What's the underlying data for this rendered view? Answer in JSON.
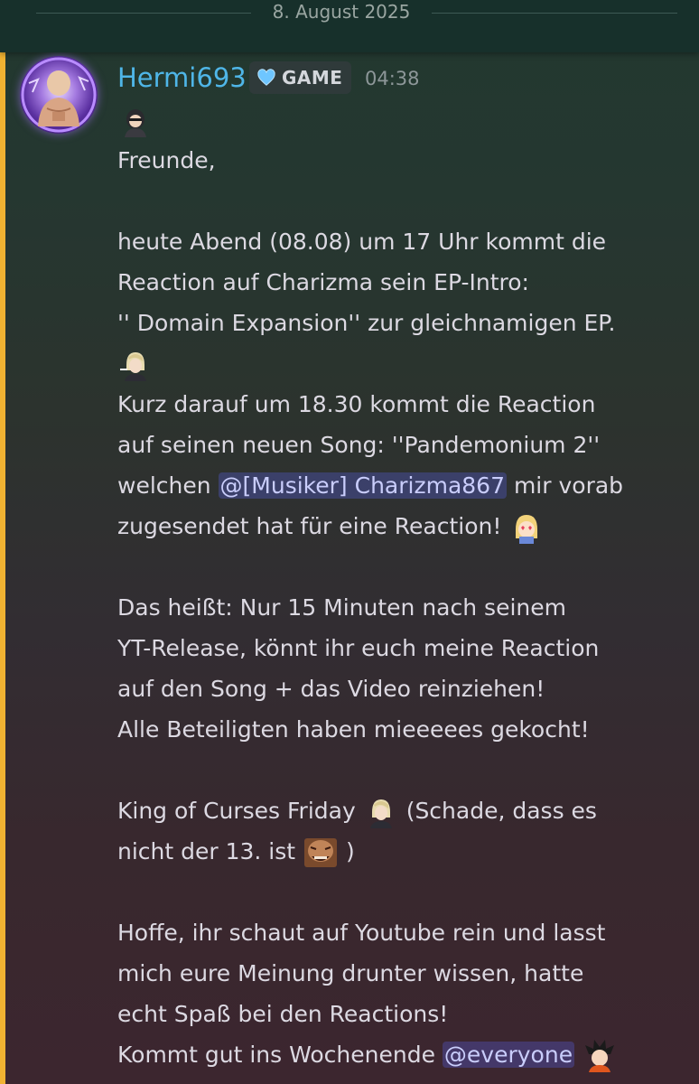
{
  "date_divider": "8. August 2025",
  "message": {
    "username": "Hermi693",
    "tag": {
      "label": "GAME",
      "icon": "heart-icon"
    },
    "timestamp": "04:38",
    "lines": {
      "l1": "Freunde,",
      "l2": "heute Abend (08.08) um 17 Uhr kommt die",
      "l3": "Reaction auf Charizma sein EP-Intro:",
      "l4": "'' Domain Expansion'' zur gleichnamigen EP.",
      "l5": "Kurz darauf um 18.30 kommt die Reaction",
      "l6": "auf seinen neuen Song: ''Pandemonium 2''",
      "l7a": "welchen",
      "l7_mention": "@[Musiker] Charizma867",
      "l7b": "mir vorab",
      "l8": "zugesendet hat für eine Reaction!",
      "l9": "Das heißt: Nur 15 Minuten nach seinem",
      "l10": "YT-Release, könnt ihr euch meine Reaction",
      "l11": "auf den Song + das Video reinziehen!",
      "l12": "Alle Beteiligten haben mieeeees gekocht!",
      "l13a": "King of Curses Friday",
      "l13b": "(Schade, dass es",
      "l14a": "nicht der 13. ist",
      "l14b": ")",
      "l15": "Hoffe, ihr schaut auf Youtube rein und lasst",
      "l16": "mich eure Meinung drunter wissen, hatte",
      "l17": "echt Spaß bei den Reactions!",
      "l18a": "Kommt gut ins Wochenende",
      "l18_mention": "@everyone"
    }
  },
  "colors": {
    "username": "#4fb6e8",
    "mention_bar": "#f0b232",
    "mention_bg": "#5865f2"
  }
}
